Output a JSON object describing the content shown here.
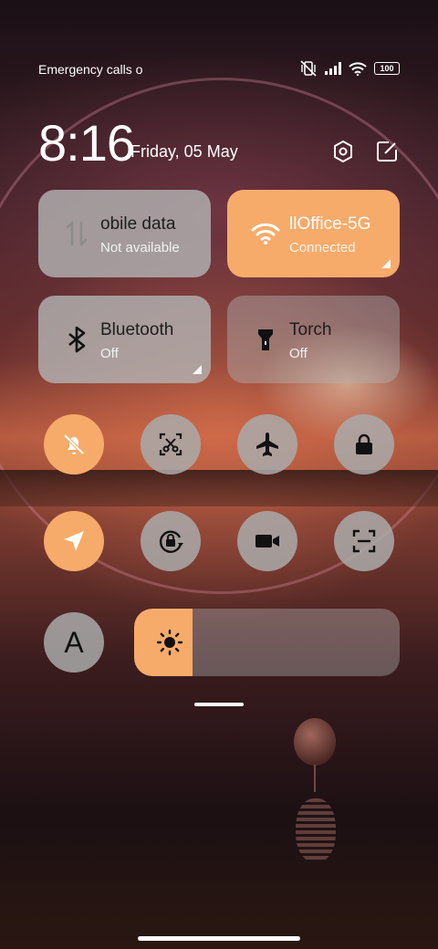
{
  "status_bar": {
    "carrier": "Emergency calls o",
    "battery": "100"
  },
  "header": {
    "time": "8:16",
    "date": "Friday, 05 May"
  },
  "tiles": [
    {
      "title": "obile data",
      "subtitle": "Not available",
      "icon": "mobile-data-icon",
      "active": false
    },
    {
      "title": "llOffice-5G",
      "subtitle": "Connected",
      "icon": "wifi-icon",
      "active": true
    },
    {
      "title": "Bluetooth",
      "subtitle": "Off",
      "icon": "bluetooth-icon",
      "active": false
    },
    {
      "title": "Torch",
      "subtitle": "Off",
      "icon": "torch-icon",
      "active": false
    }
  ],
  "toggles": [
    {
      "icon": "bell-muted-icon",
      "active": true
    },
    {
      "icon": "screenshot-icon",
      "active": false
    },
    {
      "icon": "airplane-icon",
      "active": false
    },
    {
      "icon": "lock-icon",
      "active": false
    },
    {
      "icon": "location-icon",
      "active": true
    },
    {
      "icon": "rotation-lock-icon",
      "active": false
    },
    {
      "icon": "video-camera-icon",
      "active": false
    },
    {
      "icon": "scan-icon",
      "active": false
    }
  ],
  "font_toggle": {
    "label": "A"
  },
  "brightness": {
    "level_percent": 22
  },
  "colors": {
    "accent": "#f7ab6a",
    "tile_off": "#b2b2b2"
  }
}
